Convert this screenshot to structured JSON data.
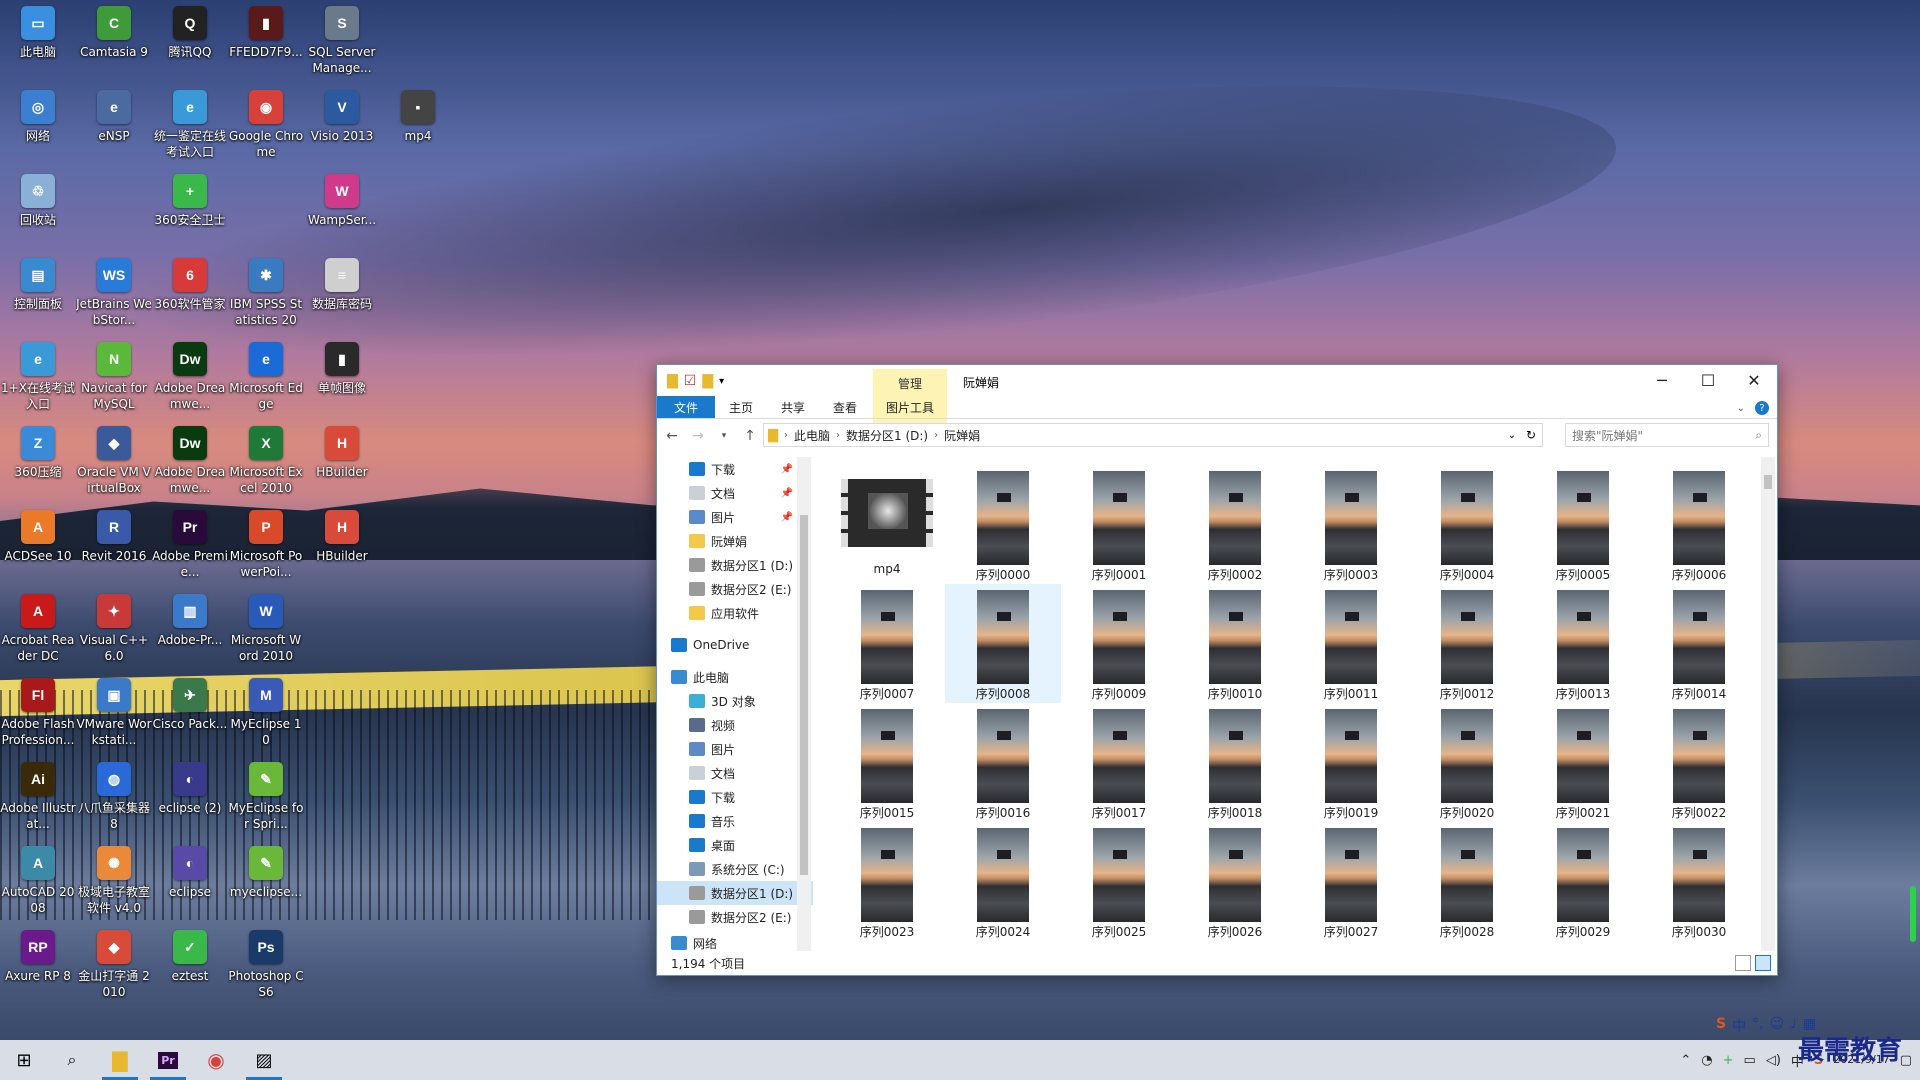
{
  "desktop_icons": [
    {
      "label": "此电脑",
      "glyph": "▭",
      "color": "#3a8fe0"
    },
    {
      "label": "Camtasia 9",
      "glyph": "C",
      "color": "#3f9b3a"
    },
    {
      "label": "腾讯QQ",
      "glyph": "Q",
      "color": "#222222"
    },
    {
      "label": "FFEDD7F9...",
      "glyph": "▮",
      "color": "#5a1a1a"
    },
    {
      "label": "SQL Server Manage...",
      "glyph": "S",
      "color": "#6a7a8a"
    },
    {
      "label": "网络",
      "glyph": "◎",
      "color": "#3a7fd0"
    },
    {
      "label": "eNSP",
      "glyph": "e",
      "color": "#4a6aa0"
    },
    {
      "label": "统一鉴定在线考试入口",
      "glyph": "e",
      "color": "#3a9ad8"
    },
    {
      "label": "Google Chrome",
      "glyph": "◉",
      "color": "#d8413a"
    },
    {
      "label": "Visio 2013",
      "glyph": "V",
      "color": "#2c5aa0"
    },
    {
      "label": "mp4",
      "glyph": "▪",
      "color": "#444444"
    },
    {
      "label": "回收站",
      "glyph": "♲",
      "color": "#8ab0d8"
    },
    {
      "label": "360安全卫士",
      "glyph": "+",
      "color": "#3ab84a"
    },
    {
      "label": "WampSer...",
      "glyph": "W",
      "color": "#d03a8a"
    },
    {
      "label": "控制面板",
      "glyph": "▤",
      "color": "#3a8ad0"
    },
    {
      "label": "JetBrains WebStor...",
      "glyph": "WS",
      "color": "#2a7ad8"
    },
    {
      "label": "360软件管家",
      "glyph": "6",
      "color": "#d83a3a"
    },
    {
      "label": "IBM SPSS Statistics 20",
      "glyph": "✱",
      "color": "#3a7ac0"
    },
    {
      "label": "数据库密码",
      "glyph": "≡",
      "color": "#cfcfcf"
    },
    {
      "label": "1+X在线考试入口",
      "glyph": "e",
      "color": "#3a9ad8"
    },
    {
      "label": "Navicat for MySQL",
      "glyph": "N",
      "color": "#5ab83a"
    },
    {
      "label": "Adobe Dreamwe...",
      "glyph": "Dw",
      "color": "#0a3a10"
    },
    {
      "label": "Microsoft Edge",
      "glyph": "e",
      "color": "#1a6ad8"
    },
    {
      "label": "单帧图像",
      "glyph": "▮",
      "color": "#2a2a2a"
    },
    {
      "label": "360压缩",
      "glyph": "Z",
      "color": "#3a8ad8"
    },
    {
      "label": "Oracle VM VirtualBox",
      "glyph": "◆",
      "color": "#3a5a9a"
    },
    {
      "label": "Adobe Dreamwe...",
      "glyph": "Dw",
      "color": "#0a3a10"
    },
    {
      "label": "Microsoft Excel 2010",
      "glyph": "X",
      "color": "#1f7a3a"
    },
    {
      "label": "HBuilder",
      "glyph": "H",
      "color": "#d84a3a"
    },
    {
      "label": "ACDSee 10",
      "glyph": "A",
      "color": "#e87a2a"
    },
    {
      "label": "Revit 2016",
      "glyph": "R",
      "color": "#3a5aa8"
    },
    {
      "label": "Adobe Premie...",
      "glyph": "Pr",
      "color": "#2a0a3a"
    },
    {
      "label": "Microsoft PowerPoi...",
      "glyph": "P",
      "color": "#d84a2a"
    },
    {
      "label": "HBuilder",
      "glyph": "H",
      "color": "#d84a3a"
    },
    {
      "label": "Acrobat Reader DC",
      "glyph": "A",
      "color": "#c81a1a"
    },
    {
      "label": "Visual C++ 6.0",
      "glyph": "✦",
      "color": "#c83a3a"
    },
    {
      "label": "Adobe-Pr...",
      "glyph": "▥",
      "color": "#3a7ac8"
    },
    {
      "label": "Microsoft Word 2010",
      "glyph": "W",
      "color": "#2a5ab8"
    },
    {
      "label": "Adobe Flash Profession...",
      "glyph": "Fl",
      "color": "#a81a1a"
    },
    {
      "label": "VMware Workstati...",
      "glyph": "▣",
      "color": "#3a7ac8"
    },
    {
      "label": "Cisco Pack...",
      "glyph": "✈",
      "color": "#3a7a4a"
    },
    {
      "label": "MyEclipse 10",
      "glyph": "M",
      "color": "#3a5ab8"
    },
    {
      "label": "Adobe Illustrat...",
      "glyph": "Ai",
      "color": "#3a2a0a"
    },
    {
      "label": "八爪鱼采集器 8",
      "glyph": "◍",
      "color": "#2a6ad8"
    },
    {
      "label": "eclipse (2)",
      "glyph": "◐",
      "color": "#3a3a8a"
    },
    {
      "label": "MyEclipse for Spri...",
      "glyph": "✎",
      "color": "#6ab83a"
    },
    {
      "label": "AutoCAD 2008",
      "glyph": "A",
      "color": "#3a8aa8"
    },
    {
      "label": "极域电子教室软件 v4.0 2...",
      "glyph": "✺",
      "color": "#e88a3a"
    },
    {
      "label": "eclipse",
      "glyph": "◐",
      "color": "#5a4aa8"
    },
    {
      "label": "myeclipse...",
      "glyph": "✎",
      "color": "#6ab83a"
    },
    {
      "label": "Axure RP 8",
      "glyph": "RP",
      "color": "#6a1a8a"
    },
    {
      "label": "金山打字通 2010",
      "glyph": "◆",
      "color": "#d84a3a"
    },
    {
      "label": "eztest",
      "glyph": "✓",
      "color": "#3ab84a"
    },
    {
      "label": "Photoshop CS6",
      "glyph": "Ps",
      "color": "#1a3a6a"
    }
  ],
  "explorer": {
    "title": "阮婵娟",
    "contextual_tab": "管理",
    "ribbon_tabs": [
      "文件",
      "主页",
      "共享",
      "查看"
    ],
    "contextual_ribbon_tab": "图片工具",
    "breadcrumb": [
      "此电脑",
      "数据分区1 (D:)",
      "阮婵娟"
    ],
    "search_placeholder": "搜索\"阮婵娟\"",
    "nav_items": [
      {
        "label": "下载",
        "color": "#1979ca",
        "pinned": true
      },
      {
        "label": "文档",
        "color": "#c8d0d8",
        "pinned": true
      },
      {
        "label": "图片",
        "color": "#5a8ac8",
        "pinned": true
      },
      {
        "label": "阮婵娟",
        "color": "#f4c848",
        "pinned": false
      },
      {
        "label": "数据分区1 (D:)",
        "color": "#9a9a9a",
        "pinned": false
      },
      {
        "label": "数据分区2 (E:)",
        "color": "#9a9a9a",
        "pinned": false
      },
      {
        "label": "应用软件",
        "color": "#f4c848",
        "pinned": false
      },
      {
        "label": "OneDrive",
        "color": "#1979ca",
        "pinned": false
      },
      {
        "label": "此电脑",
        "color": "#3a8ad0",
        "pinned": false
      },
      {
        "label": "3D 对象",
        "color": "#3ab0d8",
        "pinned": false
      },
      {
        "label": "视频",
        "color": "#5a6a8a",
        "pinned": false
      },
      {
        "label": "图片",
        "color": "#5a8ac8",
        "pinned": false
      },
      {
        "label": "文档",
        "color": "#c8d0d8",
        "pinned": false
      },
      {
        "label": "下载",
        "color": "#1979ca",
        "pinned": false
      },
      {
        "label": "音乐",
        "color": "#1979ca",
        "pinned": false
      },
      {
        "label": "桌面",
        "color": "#1979ca",
        "pinned": false
      },
      {
        "label": "系统分区 (C:)",
        "color": "#7a9ab8",
        "pinned": false
      },
      {
        "label": "数据分区1 (D:)",
        "color": "#9a9a9a",
        "pinned": false,
        "selected": true
      },
      {
        "label": "数据分区2 (E:)",
        "color": "#9a9a9a",
        "pinned": false
      },
      {
        "label": "网络",
        "color": "#3a8ad0",
        "pinned": false
      }
    ],
    "files": [
      "mp4",
      "序列0000",
      "序列0001",
      "序列0002",
      "序列0003",
      "序列0004",
      "序列0005",
      "序列0006",
      "序列0007",
      "序列0008",
      "序列0009",
      "序列0010",
      "序列0011",
      "序列0012",
      "序列0013",
      "序列0014",
      "序列0015",
      "序列0016",
      "序列0017",
      "序列0018",
      "序列0019",
      "序列0020",
      "序列0021",
      "序列0022",
      "序列0023",
      "序列0024",
      "序列0025",
      "序列0026",
      "序列0027",
      "序列0028",
      "序列0029",
      "序列0030"
    ],
    "selected_file": "序列0008",
    "status": "1,194 个项目"
  },
  "tray": {
    "time": "",
    "date": "2021/9/17",
    "ime_label": "中"
  },
  "watermark": "最需教育"
}
